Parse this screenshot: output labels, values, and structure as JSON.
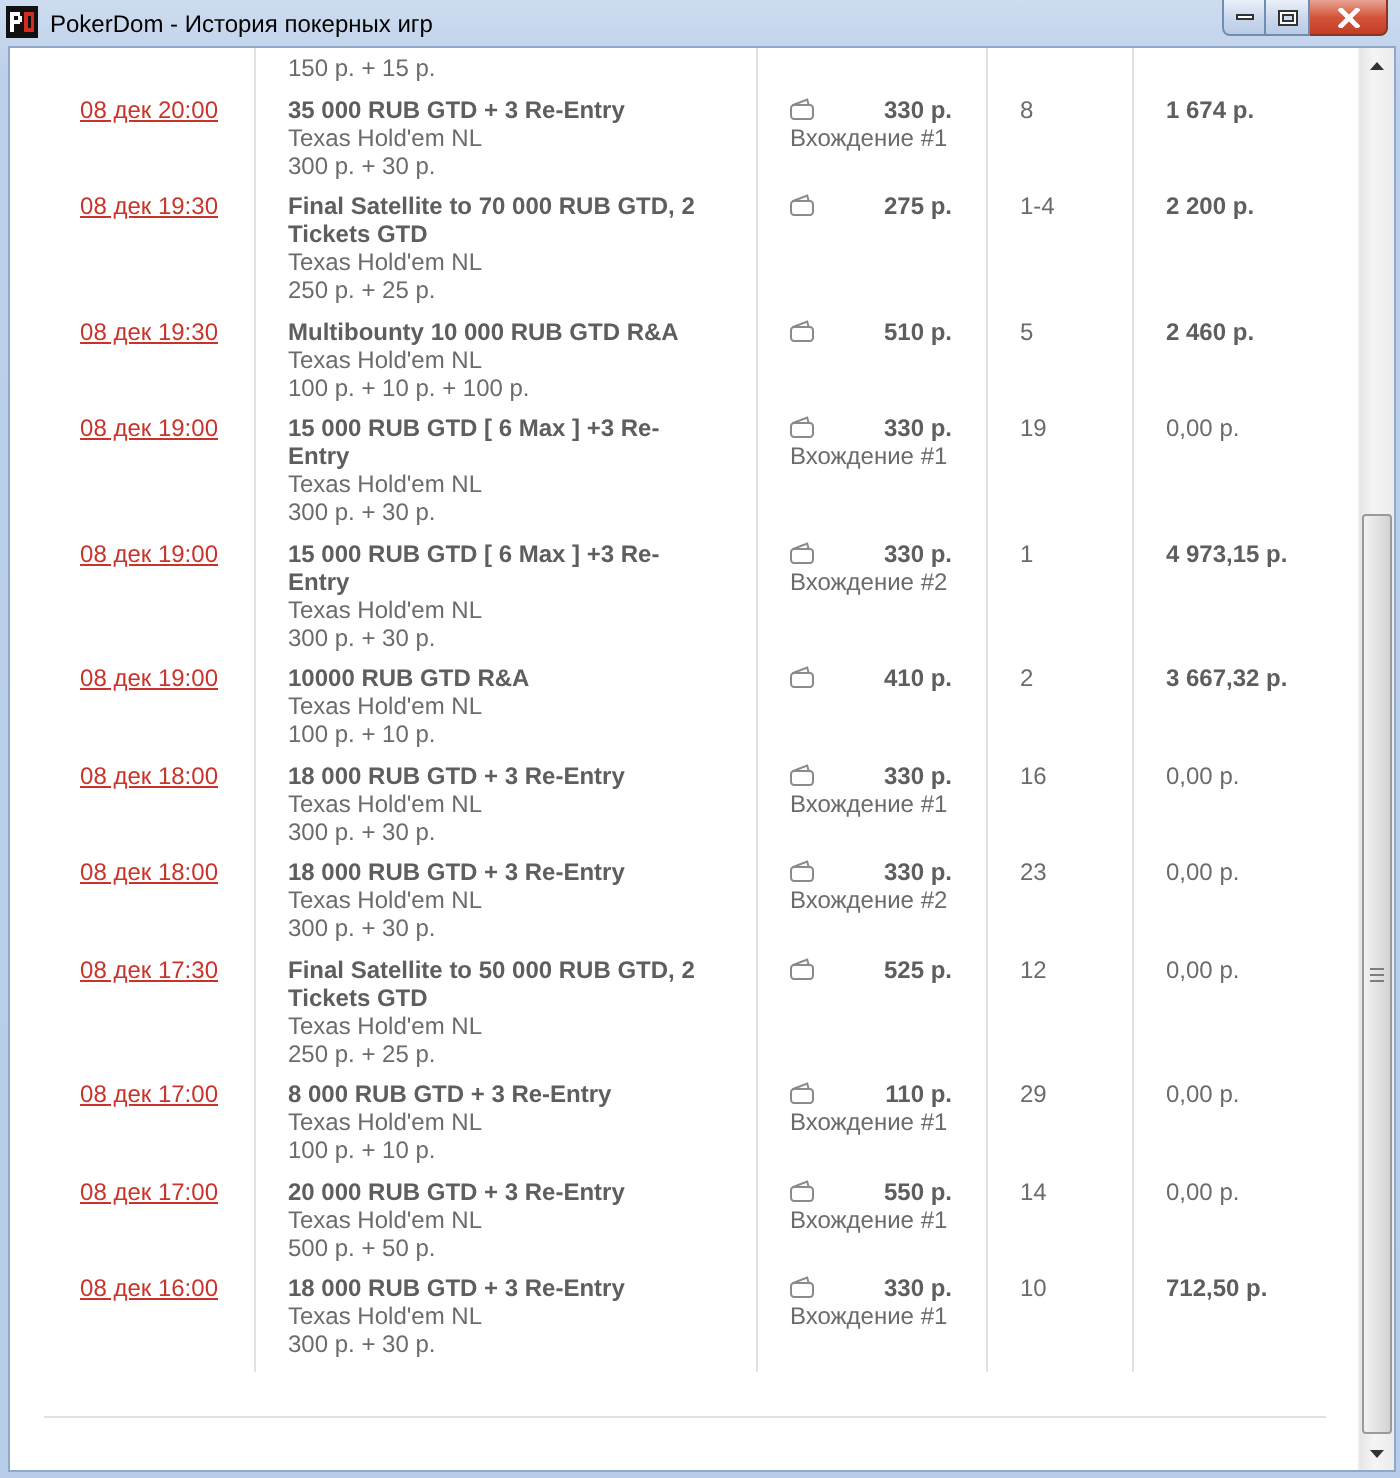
{
  "window": {
    "title": "PokerDom - История покерных игр"
  },
  "history": {
    "clipped_row": {
      "buyin": "150 р. + 15 р."
    },
    "rows": [
      {
        "date": "08 дек 20:00",
        "title": "35 000 RUB GTD + 3 Re-Entry",
        "game": "Texas Hold'em NL",
        "buyin": "300 р. + 30 р.",
        "cost": "330 р.",
        "entry": "Вхождение #1",
        "place": "8",
        "prize": "1 674 р.",
        "in_money": true
      },
      {
        "date": "08 дек 19:30",
        "title": "Final Satellite to 70 000 RUB GTD, 2 Tickets GTD",
        "game": "Texas Hold'em NL",
        "buyin": "250 р. + 25 р.",
        "cost": "275 р.",
        "place": "1-4",
        "prize": "2 200 р.",
        "in_money": true
      },
      {
        "date": "08 дек 19:30",
        "title": "Multibounty 10 000 RUB GTD R&A",
        "game": "Texas Hold'em NL",
        "buyin": "100 р. + 10 р. + 100 р.",
        "cost": "510 р.",
        "place": "5",
        "prize": "2 460 р.",
        "in_money": true
      },
      {
        "date": "08 дек 19:00",
        "title": "15 000 RUB GTD [ 6 Max ] +3 Re-Entry",
        "game": "Texas Hold'em NL",
        "buyin": "300 р. + 30 р.",
        "cost": "330 р.",
        "entry": "Вхождение #1",
        "place": "19",
        "prize": "0,00 р.",
        "in_money": false
      },
      {
        "date": "08 дек 19:00",
        "title": "15 000 RUB GTD [ 6 Max ] +3 Re-Entry",
        "game": "Texas Hold'em NL",
        "buyin": "300 р. + 30 р.",
        "cost": "330 р.",
        "entry": "Вхождение #2",
        "place": "1",
        "prize": "4 973,15 р.",
        "in_money": true
      },
      {
        "date": "08 дек 19:00",
        "title": "10000 RUB GTD R&A",
        "game": "Texas Hold'em NL",
        "buyin": "100 р. + 10 р.",
        "cost": "410 р.",
        "place": "2",
        "prize": "3 667,32 р.",
        "in_money": true
      },
      {
        "date": "08 дек 18:00",
        "title": "18 000 RUB GTD + 3 Re-Entry",
        "game": "Texas Hold'em NL",
        "buyin": "300 р. + 30 р.",
        "cost": "330 р.",
        "entry": "Вхождение #1",
        "place": "16",
        "prize": "0,00 р.",
        "in_money": false
      },
      {
        "date": "08 дек 18:00",
        "title": "18 000 RUB GTD + 3 Re-Entry",
        "game": "Texas Hold'em NL",
        "buyin": "300 р. + 30 р.",
        "cost": "330 р.",
        "entry": "Вхождение #2",
        "place": "23",
        "prize": "0,00 р.",
        "in_money": false
      },
      {
        "date": "08 дек 17:30",
        "title": "Final Satellite to 50 000 RUB GTD, 2 Tickets GTD",
        "game": "Texas Hold'em NL",
        "buyin": "250 р. + 25 р.",
        "cost": "525 р.",
        "place": "12",
        "prize": "0,00 р.",
        "in_money": false
      },
      {
        "date": "08 дек 17:00",
        "title": "8 000 RUB GTD + 3 Re-Entry",
        "game": "Texas Hold'em NL",
        "buyin": "100 р. + 10 р.",
        "cost": "110 р.",
        "entry": "Вхождение #1",
        "place": "29",
        "prize": "0,00 р.",
        "in_money": false
      },
      {
        "date": "08 дек 17:00",
        "title": "20 000 RUB GTD + 3 Re-Entry",
        "game": "Texas Hold'em NL",
        "buyin": "500 р. + 50 р.",
        "cost": "550 р.",
        "entry": "Вхождение #1",
        "place": "14",
        "prize": "0,00 р.",
        "in_money": false
      },
      {
        "date": "08 дек 16:00",
        "title": "18 000 RUB GTD + 3 Re-Entry",
        "game": "Texas Hold'em NL",
        "buyin": "300 р. + 30 р.",
        "cost": "330 р.",
        "entry": "Вхождение #1",
        "place": "10",
        "prize": "712,50 р.",
        "in_money": true
      }
    ]
  }
}
